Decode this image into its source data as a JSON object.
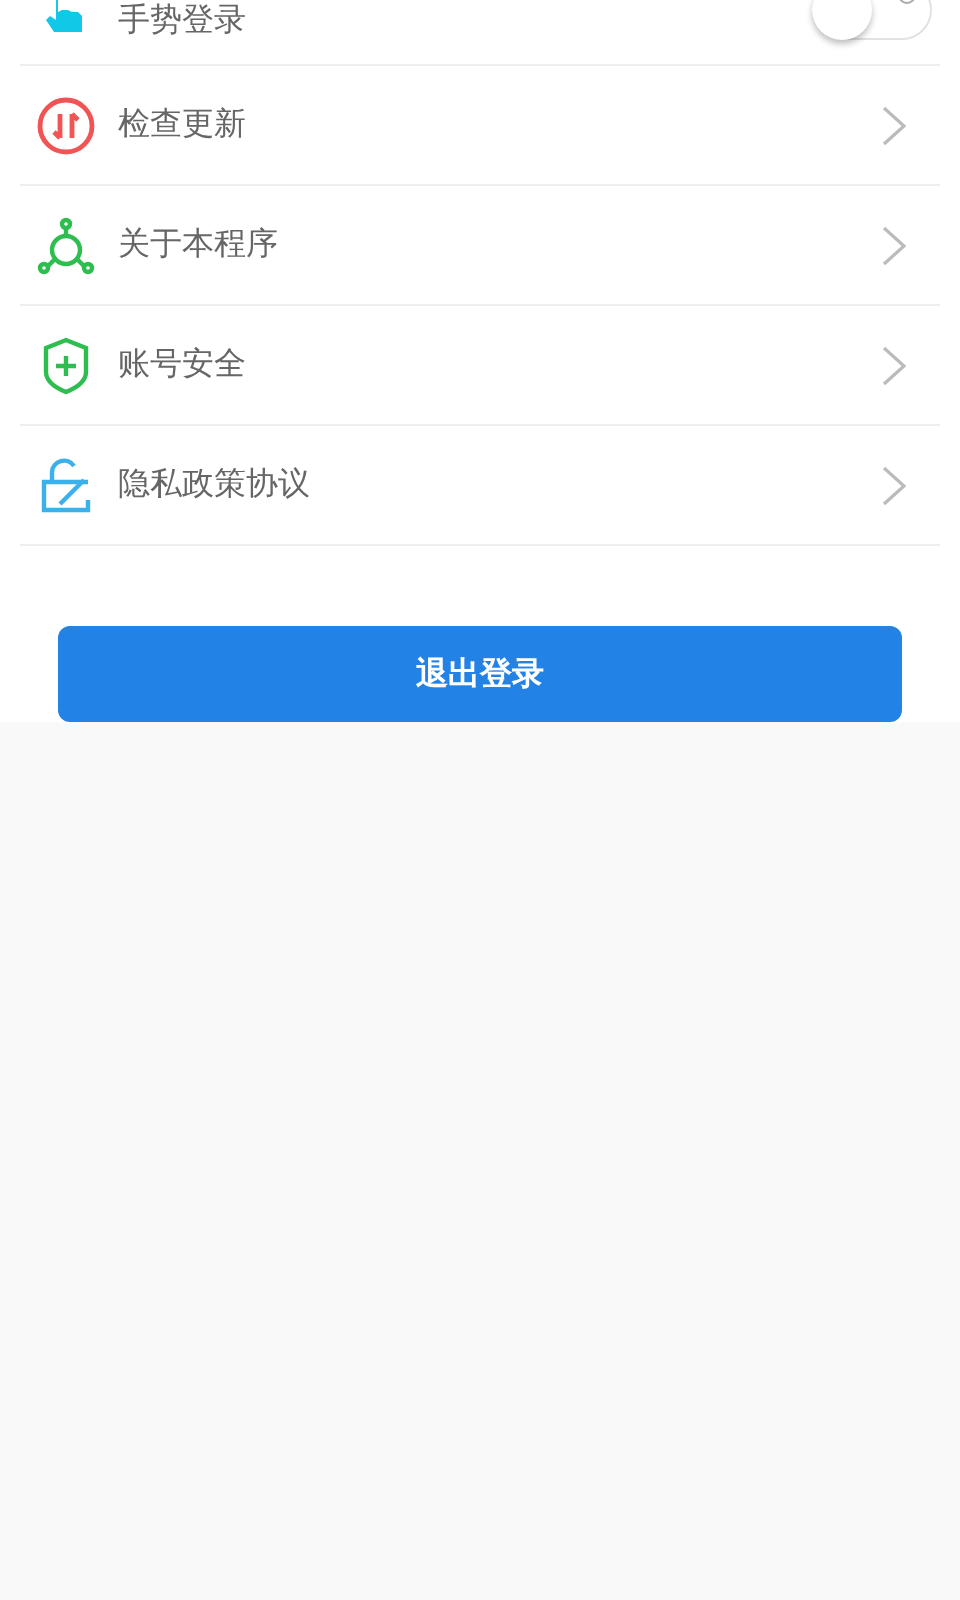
{
  "settings": [
    {
      "kind": "toggle",
      "label": "手势登录",
      "on": false
    },
    {
      "kind": "link",
      "label": "检查更新"
    },
    {
      "kind": "link",
      "label": "关于本程序"
    },
    {
      "kind": "link",
      "label": "账号安全"
    },
    {
      "kind": "link",
      "label": "隐私政策协议"
    }
  ],
  "logout_button": "退出登录"
}
